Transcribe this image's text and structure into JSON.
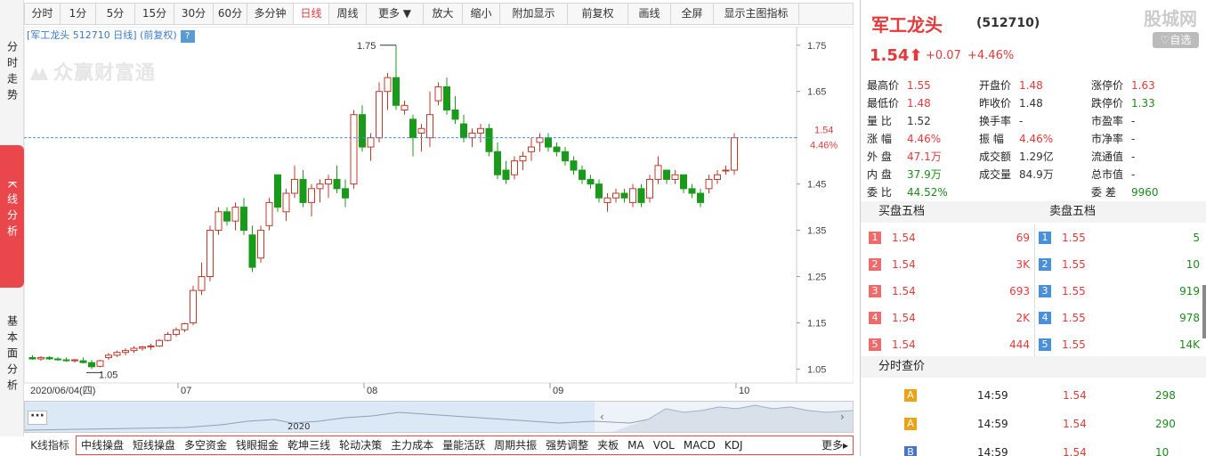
{
  "side_tabs": [
    {
      "label": "分时走势",
      "active": false
    },
    {
      "label": "K线分析",
      "active": true
    },
    {
      "label": "基本面分析",
      "active": false
    }
  ],
  "period_tabs": [
    {
      "label": "分时",
      "active": false
    },
    {
      "label": "1分",
      "active": false
    },
    {
      "label": "5分",
      "active": false
    },
    {
      "label": "15分",
      "active": false
    },
    {
      "label": "30分",
      "active": false
    },
    {
      "label": "60分",
      "active": false
    },
    {
      "label": "多分钟",
      "active": false
    },
    {
      "label": "日线",
      "active": true
    },
    {
      "label": "周线",
      "active": false
    },
    {
      "label": "更多 ▼",
      "active": false
    },
    {
      "label": "放大",
      "active": false
    },
    {
      "label": "缩小",
      "active": false
    },
    {
      "label": "附加显示",
      "active": false
    },
    {
      "label": "前复权",
      "active": false
    },
    {
      "label": "画线",
      "active": false
    },
    {
      "label": "全屏",
      "active": false
    },
    {
      "label": "显示主图指标",
      "active": false
    }
  ],
  "chart_title": "[军工龙头 512710 日线] (前复权)",
  "help_label": "?",
  "watermark": "众赢财富通",
  "chart_data": {
    "type": "candlestick",
    "symbol": "512710",
    "ylim": [
      1.02,
      1.79
    ],
    "y_ticks": [
      1.75,
      1.65,
      1.55,
      1.45,
      1.35,
      1.25,
      1.15,
      1.05
    ],
    "x_ticks": [
      "2020/06/04(四)",
      "07",
      "08",
      "09",
      "10"
    ],
    "last_price_label": "1.54",
    "last_pct_label": "4.46%",
    "high_annotation": "1.75",
    "low_annotation": "1.05",
    "up_color": "#c0392b",
    "down_color": "#1a9a1a",
    "candles": [
      [
        1.075,
        1.08,
        1.07,
        1.072
      ],
      [
        1.072,
        1.078,
        1.068,
        1.075
      ],
      [
        1.075,
        1.078,
        1.07,
        1.072
      ],
      [
        1.072,
        1.076,
        1.068,
        1.07
      ],
      [
        1.07,
        1.075,
        1.066,
        1.068
      ],
      [
        1.068,
        1.072,
        1.064,
        1.07
      ],
      [
        1.068,
        1.075,
        1.062,
        1.064
      ],
      [
        1.064,
        1.07,
        1.05,
        1.055
      ],
      [
        1.056,
        1.07,
        1.054,
        1.068
      ],
      [
        1.075,
        1.085,
        1.07,
        1.08
      ],
      [
        1.08,
        1.09,
        1.076,
        1.086
      ],
      [
        1.086,
        1.095,
        1.08,
        1.09
      ],
      [
        1.09,
        1.1,
        1.085,
        1.095
      ],
      [
        1.095,
        1.1,
        1.09,
        1.098
      ],
      [
        1.098,
        1.105,
        1.092,
        1.1
      ],
      [
        1.1,
        1.115,
        1.098,
        1.112
      ],
      [
        1.112,
        1.13,
        1.11,
        1.125
      ],
      [
        1.125,
        1.14,
        1.12,
        1.135
      ],
      [
        1.135,
        1.15,
        1.13,
        1.148
      ],
      [
        1.15,
        1.23,
        1.145,
        1.22
      ],
      [
        1.22,
        1.28,
        1.21,
        1.25
      ],
      [
        1.25,
        1.36,
        1.24,
        1.35
      ],
      [
        1.35,
        1.4,
        1.34,
        1.39
      ],
      [
        1.39,
        1.4,
        1.36,
        1.37
      ],
      [
        1.37,
        1.41,
        1.35,
        1.4
      ],
      [
        1.4,
        1.42,
        1.34,
        1.35
      ],
      [
        1.34,
        1.36,
        1.26,
        1.27
      ],
      [
        1.29,
        1.36,
        1.28,
        1.35
      ],
      [
        1.36,
        1.42,
        1.35,
        1.41
      ],
      [
        1.47,
        1.47,
        1.39,
        1.4
      ],
      [
        1.39,
        1.44,
        1.37,
        1.43
      ],
      [
        1.43,
        1.49,
        1.42,
        1.46
      ],
      [
        1.46,
        1.48,
        1.4,
        1.41
      ],
      [
        1.41,
        1.45,
        1.38,
        1.44
      ],
      [
        1.44,
        1.46,
        1.41,
        1.45
      ],
      [
        1.45,
        1.47,
        1.42,
        1.46
      ],
      [
        1.46,
        1.49,
        1.43,
        1.44
      ],
      [
        1.44,
        1.46,
        1.4,
        1.42
      ],
      [
        1.45,
        1.61,
        1.44,
        1.6
      ],
      [
        1.6,
        1.62,
        1.52,
        1.53
      ],
      [
        1.53,
        1.56,
        1.5,
        1.55
      ],
      [
        1.55,
        1.67,
        1.54,
        1.65
      ],
      [
        1.65,
        1.69,
        1.61,
        1.68
      ],
      [
        1.68,
        1.75,
        1.61,
        1.62
      ],
      [
        1.61,
        1.63,
        1.6,
        1.62
      ],
      [
        1.59,
        1.6,
        1.51,
        1.55
      ],
      [
        1.56,
        1.58,
        1.52,
        1.57
      ],
      [
        1.55,
        1.65,
        1.53,
        1.6
      ],
      [
        1.63,
        1.67,
        1.62,
        1.66
      ],
      [
        1.66,
        1.68,
        1.6,
        1.61
      ],
      [
        1.61,
        1.64,
        1.58,
        1.59
      ],
      [
        1.58,
        1.6,
        1.54,
        1.55
      ],
      [
        1.55,
        1.57,
        1.53,
        1.56
      ],
      [
        1.56,
        1.58,
        1.54,
        1.57
      ],
      [
        1.57,
        1.58,
        1.51,
        1.52
      ],
      [
        1.52,
        1.54,
        1.46,
        1.47
      ],
      [
        1.48,
        1.5,
        1.45,
        1.46
      ],
      [
        1.47,
        1.51,
        1.46,
        1.5
      ],
      [
        1.5,
        1.52,
        1.48,
        1.51
      ],
      [
        1.52,
        1.55,
        1.5,
        1.53
      ],
      [
        1.54,
        1.56,
        1.52,
        1.55
      ],
      [
        1.55,
        1.56,
        1.52,
        1.53
      ],
      [
        1.53,
        1.54,
        1.51,
        1.52
      ],
      [
        1.52,
        1.53,
        1.49,
        1.5
      ],
      [
        1.5,
        1.51,
        1.47,
        1.48
      ],
      [
        1.48,
        1.49,
        1.45,
        1.46
      ],
      [
        1.46,
        1.47,
        1.44,
        1.45
      ],
      [
        1.45,
        1.46,
        1.41,
        1.42
      ],
      [
        1.41,
        1.43,
        1.39,
        1.42
      ],
      [
        1.42,
        1.44,
        1.41,
        1.43
      ],
      [
        1.43,
        1.44,
        1.41,
        1.42
      ],
      [
        1.41,
        1.45,
        1.4,
        1.44
      ],
      [
        1.44,
        1.45,
        1.4,
        1.41
      ],
      [
        1.42,
        1.47,
        1.41,
        1.46
      ],
      [
        1.46,
        1.51,
        1.45,
        1.49
      ],
      [
        1.48,
        1.48,
        1.45,
        1.46
      ],
      [
        1.46,
        1.48,
        1.45,
        1.47
      ],
      [
        1.47,
        1.47,
        1.43,
        1.44
      ],
      [
        1.44,
        1.45,
        1.42,
        1.43
      ],
      [
        1.43,
        1.44,
        1.4,
        1.41
      ],
      [
        1.44,
        1.47,
        1.43,
        1.46
      ],
      [
        1.46,
        1.48,
        1.45,
        1.47
      ],
      [
        1.48,
        1.49,
        1.47,
        1.48
      ],
      [
        1.48,
        1.56,
        1.47,
        1.55
      ]
    ]
  },
  "navigator": {
    "dots": "···",
    "year": "2020",
    "left_arrow": "‹",
    "right_arrow": "›"
  },
  "indicator_label": "K线指标",
  "indicators": [
    "中线操盘",
    "短线操盘",
    "多空资金",
    "钱眼掘金",
    "乾坤三线",
    "轮动决策",
    "主力成本",
    "量能活跃",
    "周期共振",
    "强势调整",
    "夹板",
    "MA",
    "VOL",
    "MACD",
    "KDJ",
    "更多▸"
  ],
  "quote": {
    "name": "军工龙头",
    "code": "(512710)",
    "site_logo": "股城网",
    "watch_label": "♡自选",
    "price": "1.54⬆",
    "change": "+0.07",
    "change_pct": "+4.46%"
  },
  "quote_rows": [
    [
      {
        "label": "最高价",
        "value": "1.55",
        "color": "red"
      },
      {
        "label": "开盘价",
        "value": "1.48",
        "color": "red"
      },
      {
        "label": "涨停价",
        "value": "1.63",
        "color": "red"
      }
    ],
    [
      {
        "label": "最低价",
        "value": "1.48",
        "color": "red"
      },
      {
        "label": "昨收价",
        "value": "1.48",
        "color": "dark"
      },
      {
        "label": "跌停价",
        "value": "1.33",
        "color": "green"
      }
    ],
    [
      {
        "label": "量 比",
        "value": "1.52",
        "color": "dark"
      },
      {
        "label": "换手率",
        "value": "-",
        "color": "dark"
      },
      {
        "label": "市盈率",
        "value": "-",
        "color": "dark"
      }
    ],
    [
      {
        "label": "涨 幅",
        "value": "4.46%",
        "color": "red"
      },
      {
        "label": "振 幅",
        "value": "4.46%",
        "color": "red"
      },
      {
        "label": "市净率",
        "value": "-",
        "color": "dark"
      }
    ],
    [
      {
        "label": "外 盘",
        "value": "47.1万",
        "color": "red"
      },
      {
        "label": "成交额",
        "value": "1.29亿",
        "color": "dark"
      },
      {
        "label": "流通值",
        "value": "-",
        "color": "dark"
      }
    ],
    [
      {
        "label": "内 盘",
        "value": "37.9万",
        "color": "green"
      },
      {
        "label": "成交量",
        "value": "84.9万",
        "color": "dark"
      },
      {
        "label": "总市值",
        "value": "-",
        "color": "dark"
      }
    ],
    [
      {
        "label": "委 比",
        "value": "44.52%",
        "color": "green"
      },
      {
        "label": "",
        "value": "",
        "color": "dark"
      },
      {
        "label": "委 差",
        "value": "9960",
        "color": "green"
      }
    ]
  ],
  "book_head": {
    "buy": "买盘五档",
    "sell": "卖盘五档"
  },
  "book": [
    {
      "buy_idx": "1",
      "buy_price": "1.54",
      "buy_vol": "69",
      "sell_idx": "1",
      "sell_price": "1.55",
      "sell_vol": "5"
    },
    {
      "buy_idx": "2",
      "buy_price": "1.54",
      "buy_vol": "3K",
      "sell_idx": "2",
      "sell_price": "1.55",
      "sell_vol": "10"
    },
    {
      "buy_idx": "3",
      "buy_price": "1.54",
      "buy_vol": "693",
      "sell_idx": "3",
      "sell_price": "1.55",
      "sell_vol": "919"
    },
    {
      "buy_idx": "4",
      "buy_price": "1.54",
      "buy_vol": "2K",
      "sell_idx": "4",
      "sell_price": "1.55",
      "sell_vol": "978"
    },
    {
      "buy_idx": "5",
      "buy_price": "1.54",
      "buy_vol": "444",
      "sell_idx": "5",
      "sell_price": "1.55",
      "sell_vol": "14K"
    }
  ],
  "ticks_head": "分时查价",
  "ticks": [
    {
      "flag": "A",
      "time": "14:59",
      "price": "1.54",
      "vol": "298"
    },
    {
      "flag": "A",
      "time": "14:59",
      "price": "1.54",
      "vol": "290"
    },
    {
      "flag": "B",
      "time": "14:59",
      "price": "1.54",
      "vol": "10"
    }
  ]
}
